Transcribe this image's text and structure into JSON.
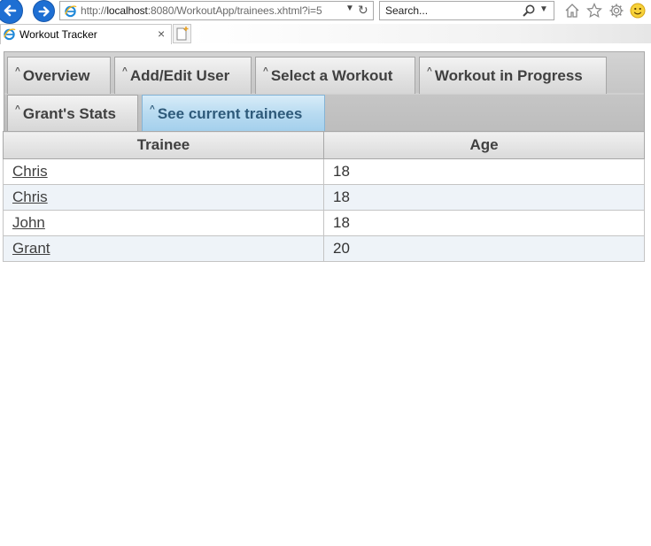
{
  "browser": {
    "url_prefix": "http://",
    "url_host": "localhost",
    "url_rest": ":8080/WorkoutApp/trainees.xhtml?i=5",
    "search_placeholder": "Search...",
    "tab_title": "Workout Tracker",
    "tab_close": "×"
  },
  "app": {
    "tabs": [
      {
        "label": "Overview",
        "caret": "^"
      },
      {
        "label": "Add/Edit User",
        "caret": "^"
      },
      {
        "label": "Select a Workout",
        "caret": "^"
      },
      {
        "label": "Workout in Progress",
        "caret": "^"
      },
      {
        "label": "Grant's Stats",
        "caret": "^"
      },
      {
        "label": "See current trainees",
        "caret": "^"
      }
    ],
    "active_tab": "See current trainees",
    "table": {
      "headers": [
        "Trainee",
        "Age"
      ],
      "rows": [
        {
          "name": "Chris",
          "age": "18"
        },
        {
          "name": "Chris",
          "age": "18"
        },
        {
          "name": "John",
          "age": "18"
        },
        {
          "name": "Grant",
          "age": "20"
        }
      ]
    }
  },
  "colors": {
    "nav_button": "#1e6fd3",
    "active_tab": "#b8dbf1",
    "alt_row": "#eef3f8"
  },
  "icons": [
    "back-arrow-icon",
    "forward-arrow-icon",
    "ie-logo-icon",
    "dropdown-icon",
    "refresh-icon",
    "search-icon",
    "home-icon",
    "favorites-star-icon",
    "settings-gear-icon",
    "smiley-feedback-icon",
    "new-tab-icon",
    "close-icon"
  ]
}
